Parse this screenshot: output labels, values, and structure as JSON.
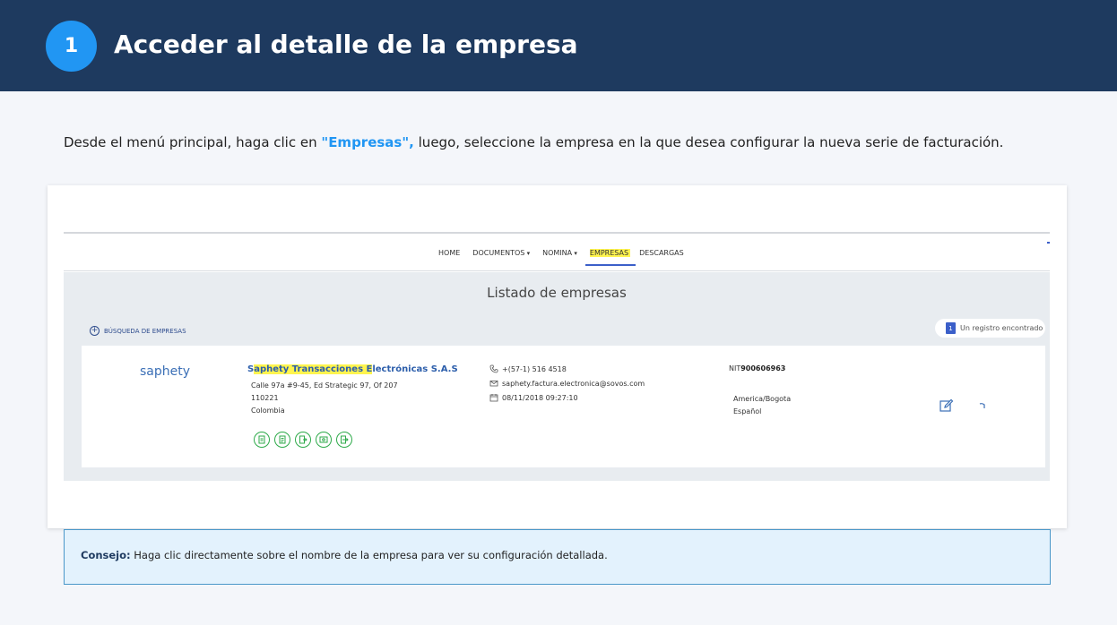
{
  "header": {
    "step_number": "1",
    "title": "Acceder al detalle de la empresa"
  },
  "instruction": {
    "before": "Desde el menú principal, haga clic en ",
    "highlight": "\"Empresas\",",
    "after": " luego, seleccione la empresa en la que desea configurar la nueva serie de facturación."
  },
  "nav": {
    "items": [
      {
        "label": "HOME"
      },
      {
        "label": "DOCUMENTOS"
      },
      {
        "label": "NOMINA"
      },
      {
        "label": "EMPRESAS"
      },
      {
        "label": "DESCARGAS"
      }
    ]
  },
  "list": {
    "title": "Listado de empresas",
    "search_label": "BÚSQUEDA DE EMPRESAS",
    "count_number": "1",
    "count_text": "Un registro encontrado"
  },
  "company": {
    "logo_text": "saphety",
    "name_prefix": "S",
    "name_highlight": "aphety Transacciones E",
    "name_suffix": "lectrónicas S.A.S",
    "address_line1": "Calle 97a #9-45, Ed Strategic 97, Of 207",
    "postal_code": "110221",
    "country": "Colombia",
    "phone": "+(57-1) 516 4518",
    "email": "saphety.factura.electronica@sovos.com",
    "date": "08/11/2018 09:27:10",
    "nit_label": "NIT",
    "nit_value": "900606963",
    "timezone": "America/Bogota",
    "language": "Español"
  },
  "tip": {
    "label": "Consejo:",
    "text": " Haga clic directamente sobre el nombre de la empresa para ver su configuración detallada."
  },
  "colors": {
    "header_bg": "#1e3a5f",
    "accent_blue": "#2196f3",
    "highlight_yellow": "#fff44f",
    "icon_green": "#2eaa4a",
    "link_blue": "#2c5eab"
  }
}
